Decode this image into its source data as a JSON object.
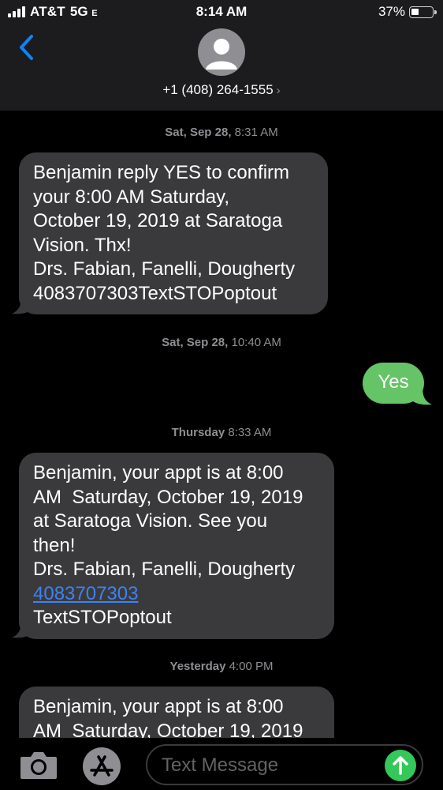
{
  "status_bar": {
    "carrier": "AT&T",
    "network": "5G",
    "network_suffix": "E",
    "time": "8:14 AM",
    "battery": "37%",
    "battery_level": 0.37
  },
  "header": {
    "contact": "+1 (408) 264-1555",
    "chevron": "›"
  },
  "messages": [
    {
      "timestamp_day": "Sat, Sep 28,",
      "timestamp_time": " 8:31 AM",
      "direction": "incoming",
      "lines": [
        "Benjamin reply YES to confirm",
        "your 8:00 AM Saturday,",
        "October 19, 2019 at Saratoga",
        "Vision. Thx!",
        "Drs. Fabian, Fanelli, Dougherty",
        "4083707303TextSTOPoptout"
      ]
    },
    {
      "timestamp_day": "Sat, Sep 28,",
      "timestamp_time": " 10:40 AM",
      "direction": "outgoing",
      "lines": [
        "Yes"
      ]
    },
    {
      "timestamp_day": "Thursday",
      "timestamp_time": " 8:33 AM",
      "direction": "incoming",
      "lines": [
        "Benjamin, your appt is at 8:00",
        "AM  Saturday, October 19, 2019",
        "at Saratoga Vision. See you",
        "then!",
        "Drs. Fabian, Fanelli, Dougherty"
      ],
      "link": "4083707303",
      "after_link": "TextSTOPoptout"
    },
    {
      "timestamp_day": "Yesterday",
      "timestamp_time": " 4:00 PM",
      "direction": "incoming",
      "lines": [
        "Benjamin, your appt is at 8:00",
        "AM  Saturday, October 19, 2019"
      ]
    }
  ],
  "input": {
    "placeholder": "Text Message"
  },
  "icons": {
    "back": "chevron-left-icon",
    "avatar": "person-icon",
    "camera": "camera-icon",
    "apps": "app-store-icon",
    "send": "arrow-up-icon"
  },
  "colors": {
    "incoming_bubble": "#3a3a3c",
    "outgoing_bubble": "#65c466",
    "link": "#3b82f6",
    "accent_blue": "#0a84ff",
    "header_bg": "#1c1c1e"
  }
}
